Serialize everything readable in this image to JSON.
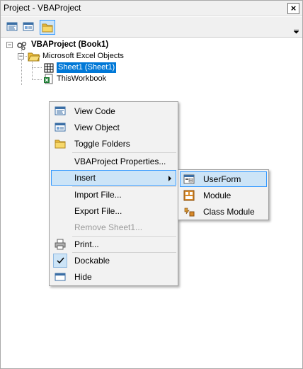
{
  "window": {
    "title": "Project - VBAProject",
    "close_glyph": "×"
  },
  "toolbar": {
    "buttons": [
      {
        "name": "view-code-icon"
      },
      {
        "name": "view-object-icon"
      },
      {
        "name": "toggle-folders-icon"
      }
    ]
  },
  "tree": {
    "project_label": "VBAProject (Book1)",
    "folder_label": "Microsoft Excel Objects",
    "sheet_label": "Sheet1 (Sheet1)",
    "workbook_label": "ThisWorkbook",
    "expander_minus": "−"
  },
  "context_menu": {
    "items": [
      {
        "label": "View Code",
        "icon": "view-code-icon"
      },
      {
        "label": "View Object",
        "icon": "view-object-icon"
      },
      {
        "label": "Toggle Folders",
        "icon": "folder-icon"
      },
      {
        "label": "VBAProject Properties..."
      },
      {
        "label": "Insert",
        "highlighted": true,
        "submenu": true
      },
      {
        "label": "Import File..."
      },
      {
        "label": "Export File..."
      },
      {
        "label": "Remove Sheet1...",
        "disabled": true
      },
      {
        "label": "Print...",
        "icon": "printer-icon"
      },
      {
        "label": "Dockable",
        "checked": true
      },
      {
        "label": "Hide",
        "icon": "hide-window-icon"
      }
    ]
  },
  "submenu": {
    "items": [
      {
        "label": "UserForm",
        "icon": "userform-icon",
        "highlighted": true
      },
      {
        "label": "Module",
        "icon": "module-icon"
      },
      {
        "label": "Class Module",
        "icon": "class-module-icon"
      }
    ]
  },
  "colors": {
    "highlight": "#cce4f7",
    "highlight_border": "#3399ff",
    "selection": "#0078d7"
  }
}
